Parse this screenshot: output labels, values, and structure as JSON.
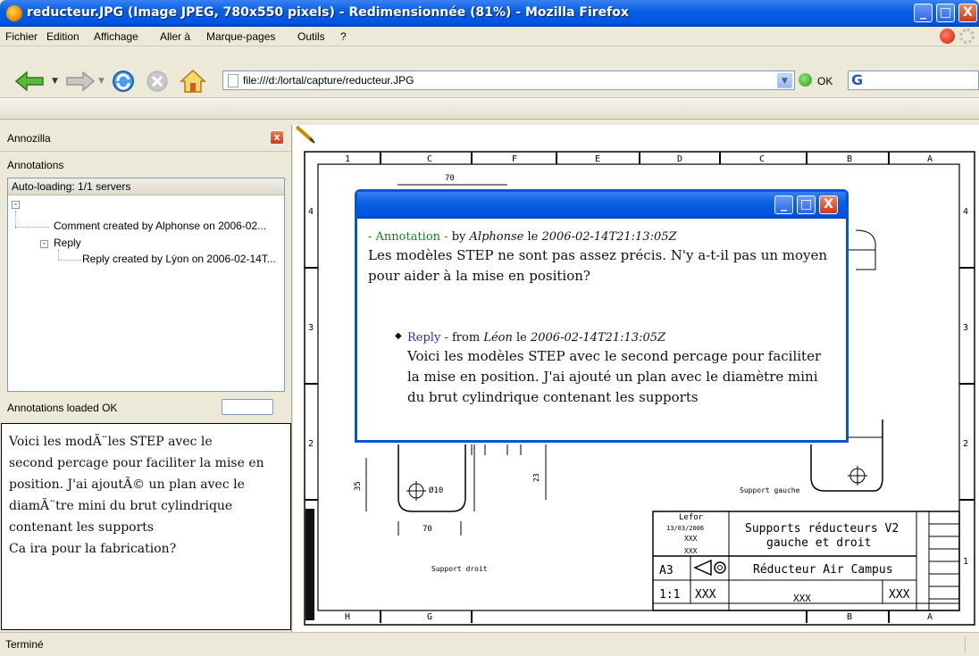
{
  "window": {
    "title": "reducteur.JPG (Image JPEG, 780x550 pixels) - Redimensionnée (81%) - Mozilla Firefox",
    "minimize": "_",
    "maximize": "□",
    "close": "X"
  },
  "menu": {
    "items": [
      "Fichier",
      "Edition",
      "Affichage",
      "Aller à",
      "Marque-pages",
      "Outils",
      "?"
    ]
  },
  "nav": {
    "url": "file:///d:/lortal/capture/reducteur.JPG",
    "go_label": "OK",
    "search_glyph": "G"
  },
  "sidebar": {
    "title": "Annozilla",
    "section_label": "Annotations",
    "tree_header": "Auto-loading: 1/1 servers",
    "tree": {
      "comment": "Comment created by Alphonse on 2006-02...",
      "reply_group": "Reply",
      "reply": "Reply created by Lýon on 2006-02-14T..."
    },
    "status": "Annotations loaded OK",
    "note_lines": [
      "Voici les modÃ¨les STEP avec le",
      "second percage pour faciliter la mise en",
      "position. J'ai ajoutÃ© un plan avec le",
      "diamÃ¨tre mini du brut cylindrique",
      "contenant les supports",
      "Ca ira pour la fabrication?"
    ]
  },
  "annotation": {
    "label": "- Annotation -",
    "by": "by",
    "author": "Alphonse",
    "le": "le",
    "date": "2006-02-14T21:13:05Z",
    "text": "Les modèles STEP ne sont pas assez précis. N'y a-t-il pas un moyen pour aider à la mise en position?",
    "reply": {
      "label": "Reply -",
      "from": "from",
      "author": "Léon",
      "le": "le",
      "date": "2006-02-14T21:13:05Z",
      "text": "Voici les modèles STEP avec le second percage pour faciliter la mise en position. J'ai ajouté un plan avec le diamètre mini du brut cylindrique contenant les supports"
    }
  },
  "drawing": {
    "col_labels_top": [
      "1",
      "C",
      "F",
      "E",
      "D",
      "C",
      "B",
      "A"
    ],
    "col_labels_bottom": [
      "H",
      "G",
      "B",
      "A"
    ],
    "row_labels": [
      "4",
      "3",
      "2",
      "1"
    ],
    "dim_top": "70",
    "dim_35": "35",
    "dim_phi": "Ø10",
    "dim_bottom": "70",
    "dim_23": "23",
    "label_droit": "Support droit",
    "label_gauche": "Support gauche",
    "tb_name": "Lefor",
    "tb_date": "13/03/2006",
    "tb_xxx": "XXX",
    "tb_title1": "Supports réducteurs V2",
    "tb_title2": "gauche et droit",
    "tb_format": "A3",
    "tb_scale": "1:1",
    "tb_project": "Réducteur Air Campus"
  },
  "statusbar": {
    "text": "Terminé"
  }
}
